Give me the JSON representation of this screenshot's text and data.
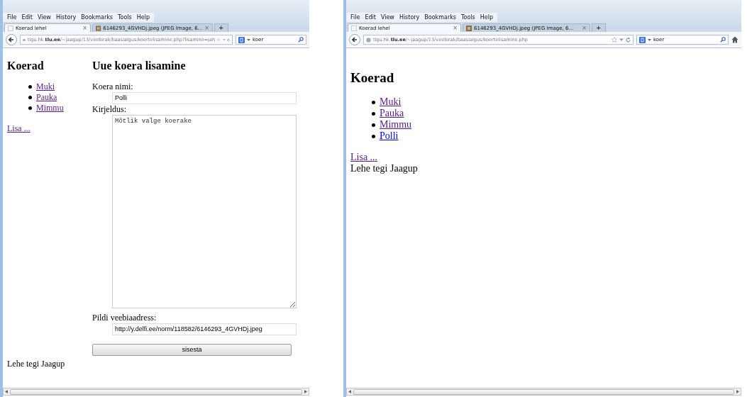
{
  "windows": [
    {
      "menu": [
        "File",
        "Edit",
        "View",
        "History",
        "Bookmarks",
        "Tools",
        "Help"
      ],
      "tabs": [
        {
          "kind": "page",
          "label": "Koerad lehel",
          "close": "×",
          "selected": true
        },
        {
          "kind": "image",
          "label": "6146293_4GVHDj.jpeg (JPEG Image, 6...",
          "close": "×",
          "selected": false
        }
      ],
      "new_tab": "+",
      "url": "tigu.hk.**tlu.ee**/~jaagup/13/veebirak/baasialgus/koertelisamine.php?lisamine=jah",
      "search": "koer",
      "home_button": false,
      "page": {
        "kind": "form",
        "heading": "Koerad",
        "links": [
          {
            "label": "Muki",
            "visited": true
          },
          {
            "label": "Pauka",
            "visited": true
          },
          {
            "label": "Mimmu",
            "visited": true
          }
        ],
        "add_link": {
          "label": "Lisa ...",
          "visited": true
        },
        "form": {
          "heading": "Uue koera lisamine",
          "fields": [
            {
              "kind": "input",
              "label": "Koera nimi:",
              "value": "Polli"
            },
            {
              "kind": "textarea",
              "label": "Kirjeldus:",
              "value": "Mõtlik valge koerake"
            },
            {
              "kind": "input",
              "label": "Pildi veebiaadress:",
              "value": "http://y.delfi.ee/norm/118582/6146293_4GVHDj.jpeg"
            }
          ],
          "submit": "sisesta"
        },
        "footer": "Lehe tegi Jaagup"
      }
    },
    {
      "menu": [
        "File",
        "Edit",
        "View",
        "History",
        "Bookmarks",
        "Tools",
        "Help"
      ],
      "tabs": [
        {
          "kind": "page",
          "label": "Koerad lehel",
          "close": "×",
          "selected": true
        },
        {
          "kind": "image",
          "label": "6146293_4GVHDj.jpeg (JPEG Image, 6...",
          "close": "×",
          "selected": false
        }
      ],
      "new_tab": "+",
      "url": "tigu.hk.**tlu.ee**/~jaagup/13/veebirak/baasialgus/koertelisamine.php",
      "search": "koer",
      "home_button": true,
      "page": {
        "kind": "plain",
        "heading": "Koerad",
        "links": [
          {
            "label": "Muki",
            "visited": true
          },
          {
            "label": "Pauka",
            "visited": true
          },
          {
            "label": "Mimmu",
            "visited": true
          },
          {
            "label": "Polli",
            "visited": false
          }
        ],
        "add_link": {
          "label": "Lisa ...",
          "visited": true
        },
        "footer": "Lehe tegi Jaagup"
      }
    }
  ]
}
